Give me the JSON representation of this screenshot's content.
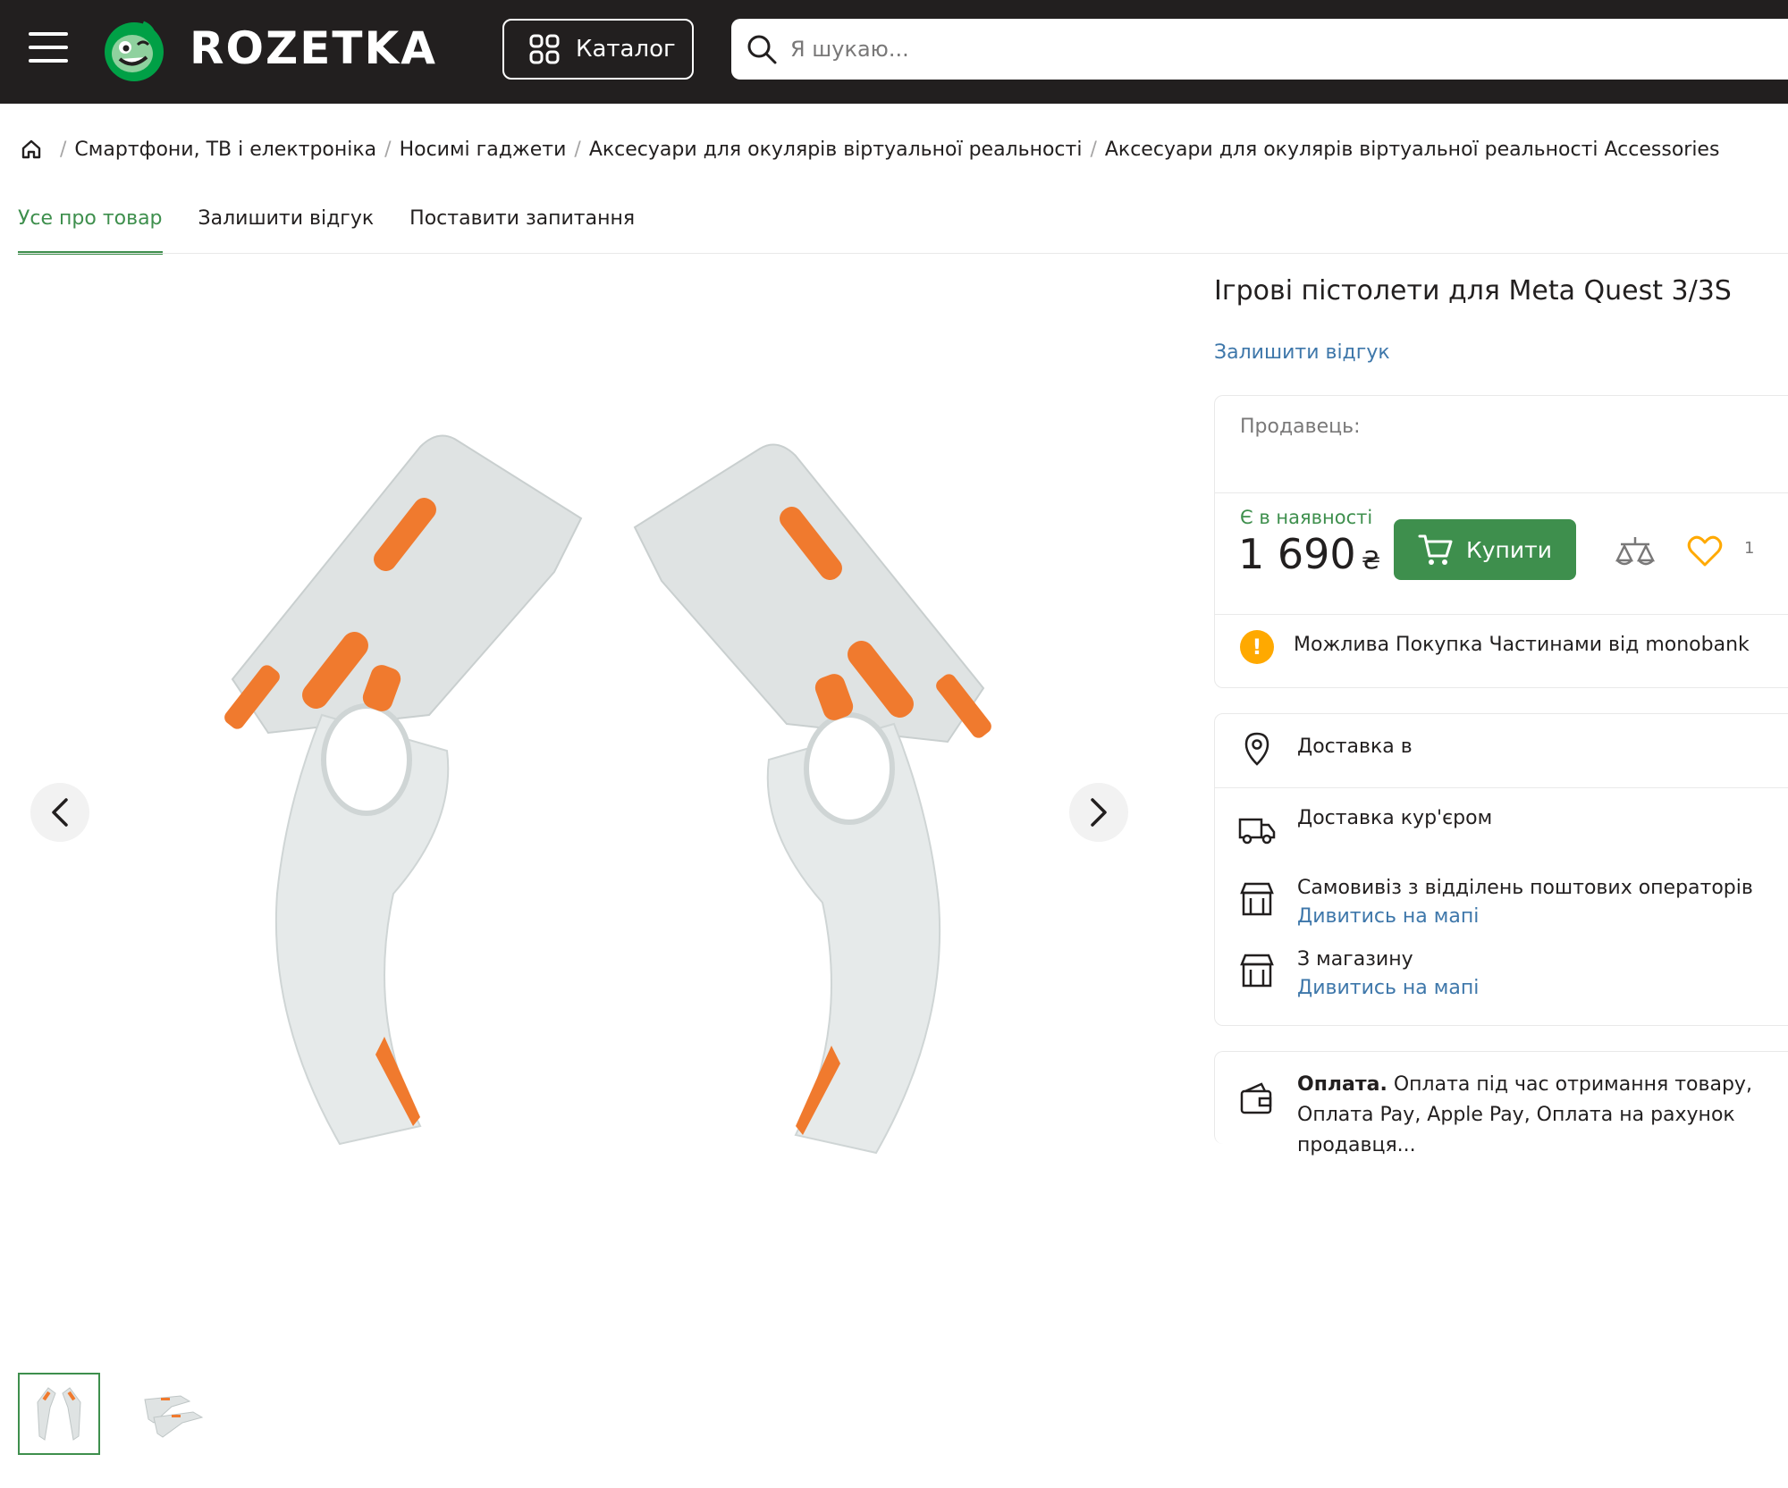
{
  "header": {
    "logo_text": "ROZETKA",
    "catalog_label": "Каталог",
    "search_placeholder": "Я шукаю..."
  },
  "breadcrumbs": [
    "Смартфони, ТВ і електроніка",
    "Носимі гаджети",
    "Аксесуари для окулярів віртуальної реальності",
    "Аксесуари для окулярів віртуальної реальності Accessories"
  ],
  "tabs": [
    {
      "label": "Усе про товар",
      "active": true
    },
    {
      "label": "Залишити відгук",
      "active": false
    },
    {
      "label": "Поставити запитання",
      "active": false
    }
  ],
  "product": {
    "title": "Ігрові пістолети для Meta Quest 3/3S",
    "review_link": "Залишити відгук",
    "seller_label": "Продавець:",
    "stock_status": "Є в наявності",
    "price": "1 690",
    "currency": "₴",
    "buy_label": "Купити",
    "favorites_count": "1",
    "installment_text": "Можлива Покупка Частинами від monobank"
  },
  "delivery": {
    "header": "Доставка в",
    "options": [
      {
        "label": "Доставка кур'єром",
        "icon": "truck-icon"
      },
      {
        "label": "Самовивіз з відділень поштових операторів",
        "link": "Дивитись на мапі",
        "icon": "store-icon"
      },
      {
        "label": "З магазину",
        "link": "Дивитись на мапі",
        "icon": "store-icon"
      }
    ]
  },
  "payment": {
    "label": "Оплата.",
    "text": " Оплата під час отримання товару, Оплата Pay, Apple Pay, Оплата на рахунок продавця..."
  },
  "colors": {
    "brand_green": "#3e8f4d",
    "header_bg": "#221f1f",
    "link_blue": "#3e77aa",
    "warning": "#ffa900",
    "product_orange": "#f07a2e",
    "product_gray": "#dfe3e3"
  }
}
